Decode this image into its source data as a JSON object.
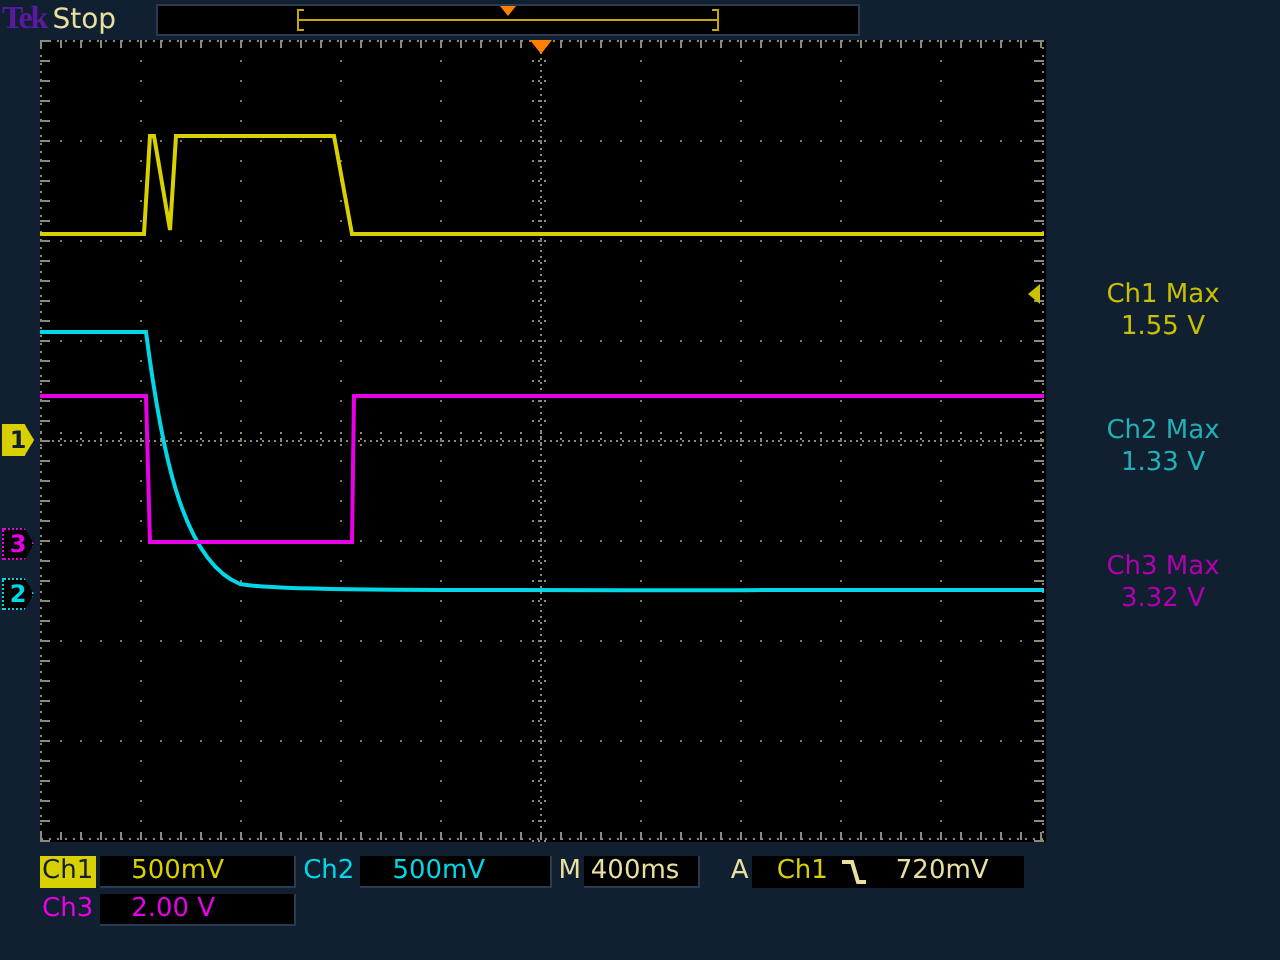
{
  "status": {
    "brand": "Tek",
    "state": "Stop"
  },
  "channels": [
    {
      "name": "Ch1",
      "scale": "500mV",
      "color": "#d8d000",
      "selected": true
    },
    {
      "name": "Ch2",
      "scale": "500mV",
      "color": "#00d8e8",
      "selected": false
    },
    {
      "name": "Ch3",
      "scale": "2.00 V",
      "color": "#e800e8",
      "selected": false
    }
  ],
  "markers": [
    {
      "label": "1",
      "color": "#d8d000",
      "selected": true
    },
    {
      "label": "3",
      "color": "#e800e8",
      "selected": false
    },
    {
      "label": "2",
      "color": "#00d8e8",
      "selected": false
    }
  ],
  "measurements": [
    {
      "label": "Ch1 Max",
      "value": "1.55 V",
      "color": "#c8c000"
    },
    {
      "label": "Ch2 Max",
      "value": "1.33 V",
      "color": "#20b0b8"
    },
    {
      "label": "Ch3 Max",
      "value": "3.32 V",
      "color": "#b000b0"
    }
  ],
  "timebase": {
    "label": "M",
    "value": "400ms"
  },
  "trigger": {
    "label": "A",
    "source": "Ch1",
    "level": "720mV"
  }
}
